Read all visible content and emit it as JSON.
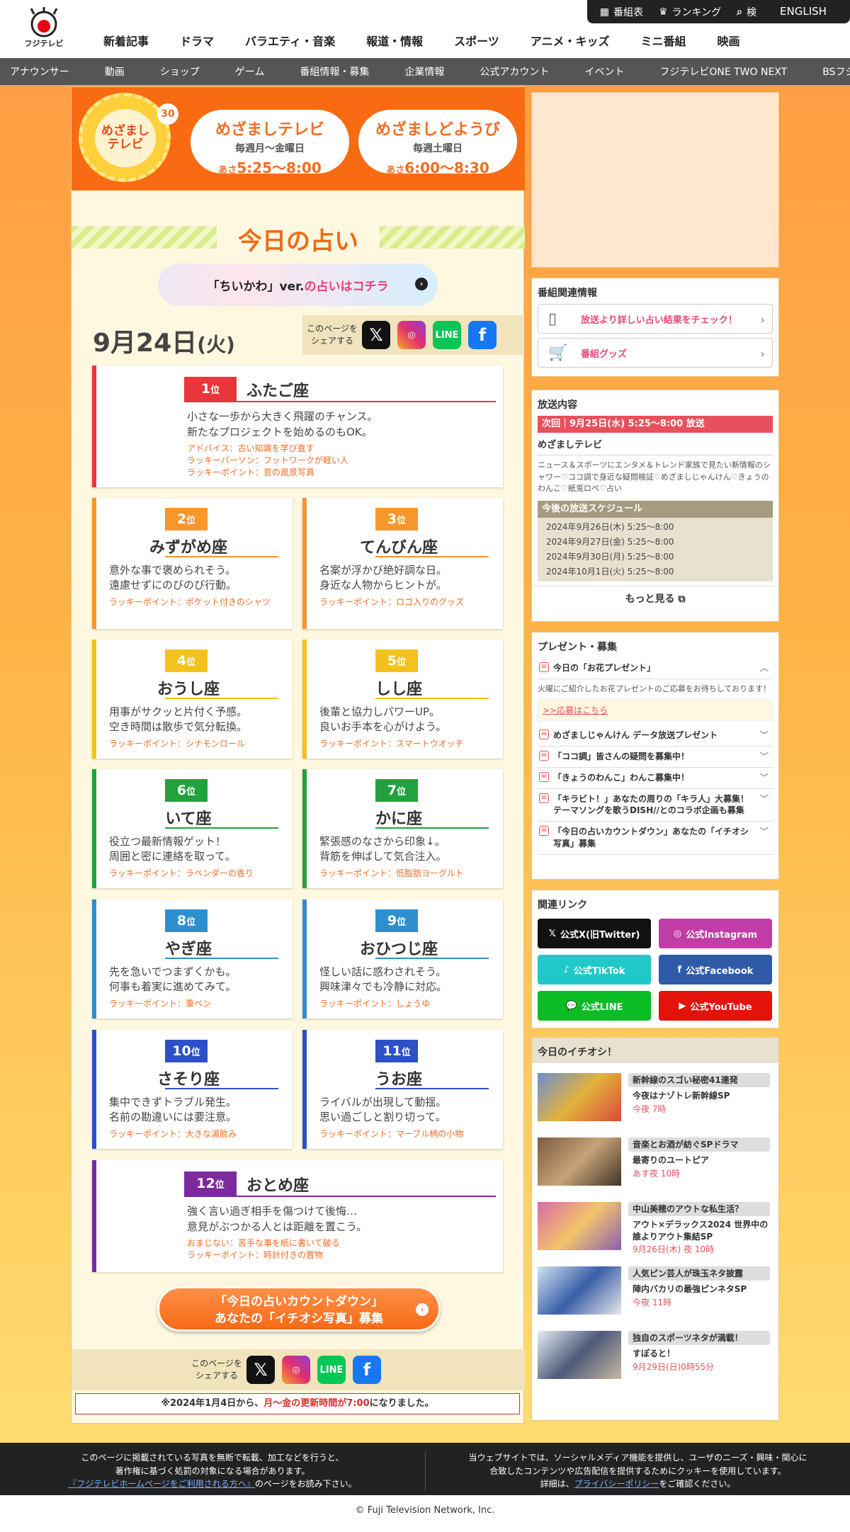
{
  "header": {
    "logo_text": "フジテレビ",
    "top_links": [
      "番組表",
      "ランキング",
      "検索"
    ],
    "english": "ENGLISH",
    "main_nav": [
      "新着記事",
      "ドラマ",
      "バラエティ・音楽",
      "報道・情報",
      "スポーツ",
      "アニメ・キッズ",
      "ミニ番組",
      "映画"
    ],
    "sub_nav": [
      "アナウンサー",
      "動画",
      "ショップ",
      "ゲーム",
      "番組情報・募集",
      "企業情報",
      "公式アカウント",
      "イベント",
      "フジテレビONE TWO NEXT",
      "BSフジ"
    ]
  },
  "banner": {
    "logo": "めざまし\nテレビ",
    "anniv": "30",
    "pill1": {
      "title": "めざましテレビ",
      "days": "毎週月〜金曜日",
      "prefix": "あさ",
      "time": "5:25〜8:00"
    },
    "pill2": {
      "title": "めざましどようび",
      "days": "毎週土曜日",
      "prefix": "あさ",
      "time": "6:00〜8:30"
    }
  },
  "page": {
    "title": "今日の占い",
    "chiikawa_pre": "「ちいかわ」ver.",
    "chiikawa_link": "の占いはコチラ",
    "date_main": "9月24日",
    "date_dow": "(火)",
    "share_label": "このページを\nシェアする",
    "cta_line1": "「今日の占いカウントダウン」",
    "cta_line2": "あなたの「イチオシ写真」募集",
    "notice_pre": "※2024年1月4日から、",
    "notice_red": "月〜金の更新時間が7:00",
    "notice_post": "になりました。"
  },
  "ranks": [
    {
      "rank": "1",
      "sign": "ふたご座",
      "msg1": "小さな一歩から大きく飛躍のチャンス。",
      "msg2": "新たなプロジェクトを始めるのもOK。",
      "l1": "アドバイス：古い知識を学び直す",
      "l2": "ラッキーパーソン：フットワークが軽い人",
      "l3": "ラッキーポイント：昔の風景写真"
    },
    {
      "rank": "2",
      "sign": "みずがめ座",
      "msg1": "意外な事で褒められそう。",
      "msg2": "遠慮せずにのびのび行動。",
      "l1": "ラッキーポイント：ポケット付きのシャツ"
    },
    {
      "rank": "3",
      "sign": "てんびん座",
      "msg1": "名案が浮かび絶好調な日。",
      "msg2": "身近な人物からヒントが。",
      "l1": "ラッキーポイント：ロゴ入りのグッズ"
    },
    {
      "rank": "4",
      "sign": "おうし座",
      "msg1": "用事がサクッと片付く予感。",
      "msg2": "空き時間は散歩で気分転換。",
      "l1": "ラッキーポイント：シナモンロール"
    },
    {
      "rank": "5",
      "sign": "しし座",
      "msg1": "後輩と協力しパワーUP。",
      "msg2": "良いお手本を心がけよう。",
      "l1": "ラッキーポイント：スマートウオッチ"
    },
    {
      "rank": "6",
      "sign": "いて座",
      "msg1": "役立つ最新情報ゲット！",
      "msg2": "周囲と密に連絡を取って。",
      "l1": "ラッキーポイント：ラベンダーの香り"
    },
    {
      "rank": "7",
      "sign": "かに座",
      "msg1": "緊張感のなさから印象↓。",
      "msg2": "背筋を伸ばして気合注入。",
      "l1": "ラッキーポイント：低脂肪ヨーグルト"
    },
    {
      "rank": "8",
      "sign": "やぎ座",
      "msg1": "先を急いでつまずくかも。",
      "msg2": "何事も着実に進めてみて。",
      "l1": "ラッキーポイント：筆ペン"
    },
    {
      "rank": "9",
      "sign": "おひつじ座",
      "msg1": "怪しい話に惑わされそう。",
      "msg2": "興味津々でも冷静に対応。",
      "l1": "ラッキーポイント：しょうゆ"
    },
    {
      "rank": "10",
      "sign": "さそり座",
      "msg1": "集中できずトラブル発生。",
      "msg2": "名前の勘違いには要注意。",
      "l1": "ラッキーポイント：大きな湯飲み"
    },
    {
      "rank": "11",
      "sign": "うお座",
      "msg1": "ライバルが出現して動揺。",
      "msg2": "思い過ごしと割り切って。",
      "l1": "ラッキーポイント：マーブル柄の小物"
    },
    {
      "rank": "12",
      "sign": "おとめ座",
      "msg1": "強く言い過ぎ相手を傷つけて後悔…",
      "msg2": "意見がぶつかる人とは距離を置こう。",
      "l1": "おまじない：苦手な事を紙に書いて破る",
      "l2": "ラッキーポイント：時計付きの置物"
    }
  ],
  "rank_suffix": "位",
  "rank_colors": {
    "1": "#e8363c",
    "2": "#f7962b",
    "3": "#f7962b",
    "4": "#f4c21c",
    "5": "#f4c21c",
    "6": "#21a23f",
    "7": "#21a23f",
    "8": "#2d8fce",
    "9": "#2d8fce",
    "10": "#2d4fc7",
    "11": "#2d4fc7",
    "12": "#7c2a9e"
  },
  "sidebar": {
    "related_title": "番組関連情報",
    "related": [
      "放送より詳しい占い結果をチェック！",
      "番組グッズ"
    ],
    "broadcast_title": "放送内容",
    "next": "次回｜9月25日(水) 5:25〜8:00 放送",
    "show": "めざましテレビ",
    "desc": "ニュース＆スポーツにエンタメ＆トレンド家族で見たい新情報のシャワー♡ココ調で身近な疑問検証♡めざましじゃんけん♡きょうのわんこ♡紙兎ロペ♡占い",
    "sched_title": "今後の放送スケジュール",
    "sched": [
      "2024年9月26日(木) 5:25〜8:00",
      "2024年9月27日(金) 5:25〜8:00",
      "2024年9月30日(月) 5:25〜8:00",
      "2024年10月1日(火) 5:25〜8:00"
    ],
    "more": "もっと見る",
    "present_title": "プレゼント・募集",
    "present_open": "今日の「お花プレゼント」",
    "present_open_desc": "火曜にご紹介したお花プレゼントのご応募をお待ちしております！",
    "present_open_link": ">>応募はこちら",
    "present_items": [
      "めざましじゃんけん データ放送プレゼント",
      "「ココ調」皆さんの疑問を募集中！",
      "「きょうのわんこ」わんこ募集中！",
      "「キラビト！」あなたの周りの「キラ人」大募集！テーマソングを歌うDISH//とのコラボ企画も募集",
      "「今日の占いカウントダウン」あなたの「イチオシ写真」募集"
    ],
    "links_title": "関連リンク",
    "links": [
      "公式X(旧Twitter)",
      "公式Instagram",
      "公式TikTok",
      "公式Facebook",
      "公式LINE",
      "公式YouTube"
    ],
    "pick_title": "今日のイチオシ！",
    "picks": [
      {
        "tag": "新幹線のスゴい秘密41連発",
        "title": "今夜はナゾトレ新幹線SP",
        "time": "今夜 7時"
      },
      {
        "tag": "音楽とお酒が紡ぐSPドラマ",
        "title": "最寄りのユートピア",
        "time": "あす夜 10時"
      },
      {
        "tag": "中山美穂のアウトな私生活？",
        "title": "アウト×デラックス2024 世界中の誰よりアウト集結SP",
        "time": "9月26日(木) 夜 10時"
      },
      {
        "tag": "人気ピン芸人が珠玉ネタ披露",
        "title": "陣内バカリの最強ピンネタSP",
        "time": "今夜 11時"
      },
      {
        "tag": "独自のスポーツネタが満載！",
        "title": "すぽると！",
        "time": "9月29日(日)0時55分"
      }
    ]
  },
  "footer": {
    "left1": "このページに掲載されている写真を無断で転載、加工などを行うと、",
    "left2": "著作権に基づく処罰の対象になる場合があります。",
    "left_link": "『フジテレビホームページをご利用される方へ』",
    "left3": "のページをお読み下さい。",
    "right1": "当ウェブサイトでは、ソーシャルメディア機能を提供し、ユーザのニーズ・興味・関心に",
    "right2": "合致したコンテンツや広告配信を提供するためにクッキーを使用しています。",
    "right3_pre": "詳細は、",
    "right_link": "プライバシーポリシー",
    "right3_post": "をご確認ください。",
    "copyright": "© Fuji Television Network, Inc."
  }
}
